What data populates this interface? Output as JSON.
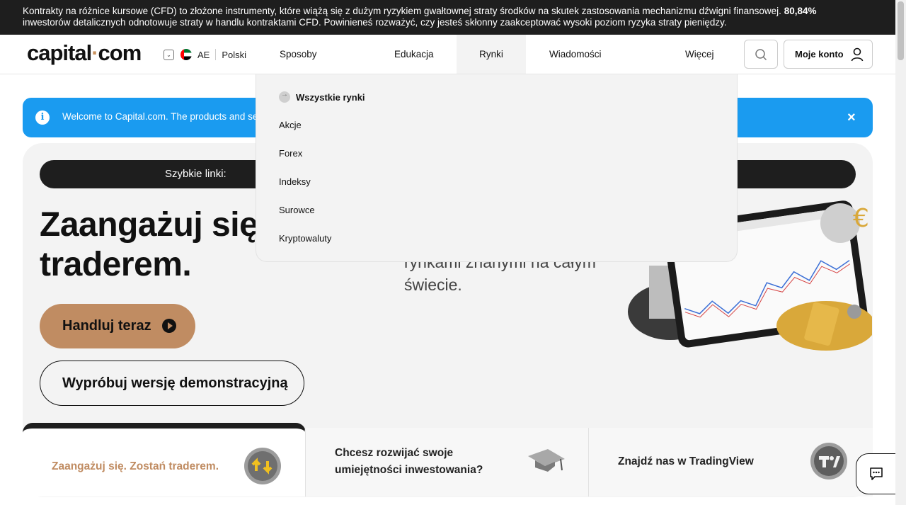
{
  "risk_warning": {
    "text_before": "Kontrakty na różnice kursowe (CFD) to złożone instrumenty, które wiążą się z dużym ryzykiem gwałtownej straty środków na skutek zastosowania mechanizmu dźwigni finansowej.",
    "percent": "80,84%",
    "text_after": "inwestorów detalicznych odnotowuje straty w handlu kontraktami CFD. Powinieneś rozważyć, czy jesteś skłonny zaakceptować wysoki poziom ryzyka straty pieniędzy."
  },
  "header": {
    "logo_left": "capital",
    "logo_dot": "·",
    "logo_right": "com",
    "region": "AE",
    "language": "Polski",
    "nav": [
      "Sposoby handlu",
      "Edukacja",
      "Rynki",
      "Wiadomości i analizy",
      "Więcej"
    ],
    "account_label": "Moje konto"
  },
  "welcome": {
    "text": "Welcome to Capital.com. The products and se",
    "info_glyph": "i",
    "close_glyph": "×"
  },
  "hero": {
    "quick_links": "Szybkie linki:",
    "title_line1": "Zaangażuj się",
    "title_line2": "traderem.",
    "subtitle_line1": "rynkami znanymi na całym",
    "subtitle_line2": "świecie.",
    "trade_button": "Handluj teraz",
    "demo_button": "Wypróbuj wersję demonstracyjną"
  },
  "cards": [
    {
      "line1": "Zaangażuj się. Zostań traderem.",
      "line2": ""
    },
    {
      "line1": "Chcesz rozwijać swoje",
      "line2": "umiejętności inwestowania?"
    },
    {
      "line1": "Znajdź nas w TradingView",
      "line2": ""
    }
  ],
  "dropdown": {
    "all_markets": "Wszystkie rynki",
    "items": [
      "Akcje",
      "Forex",
      "Indeksy",
      "Surowce",
      "Kryptowaluty"
    ]
  }
}
